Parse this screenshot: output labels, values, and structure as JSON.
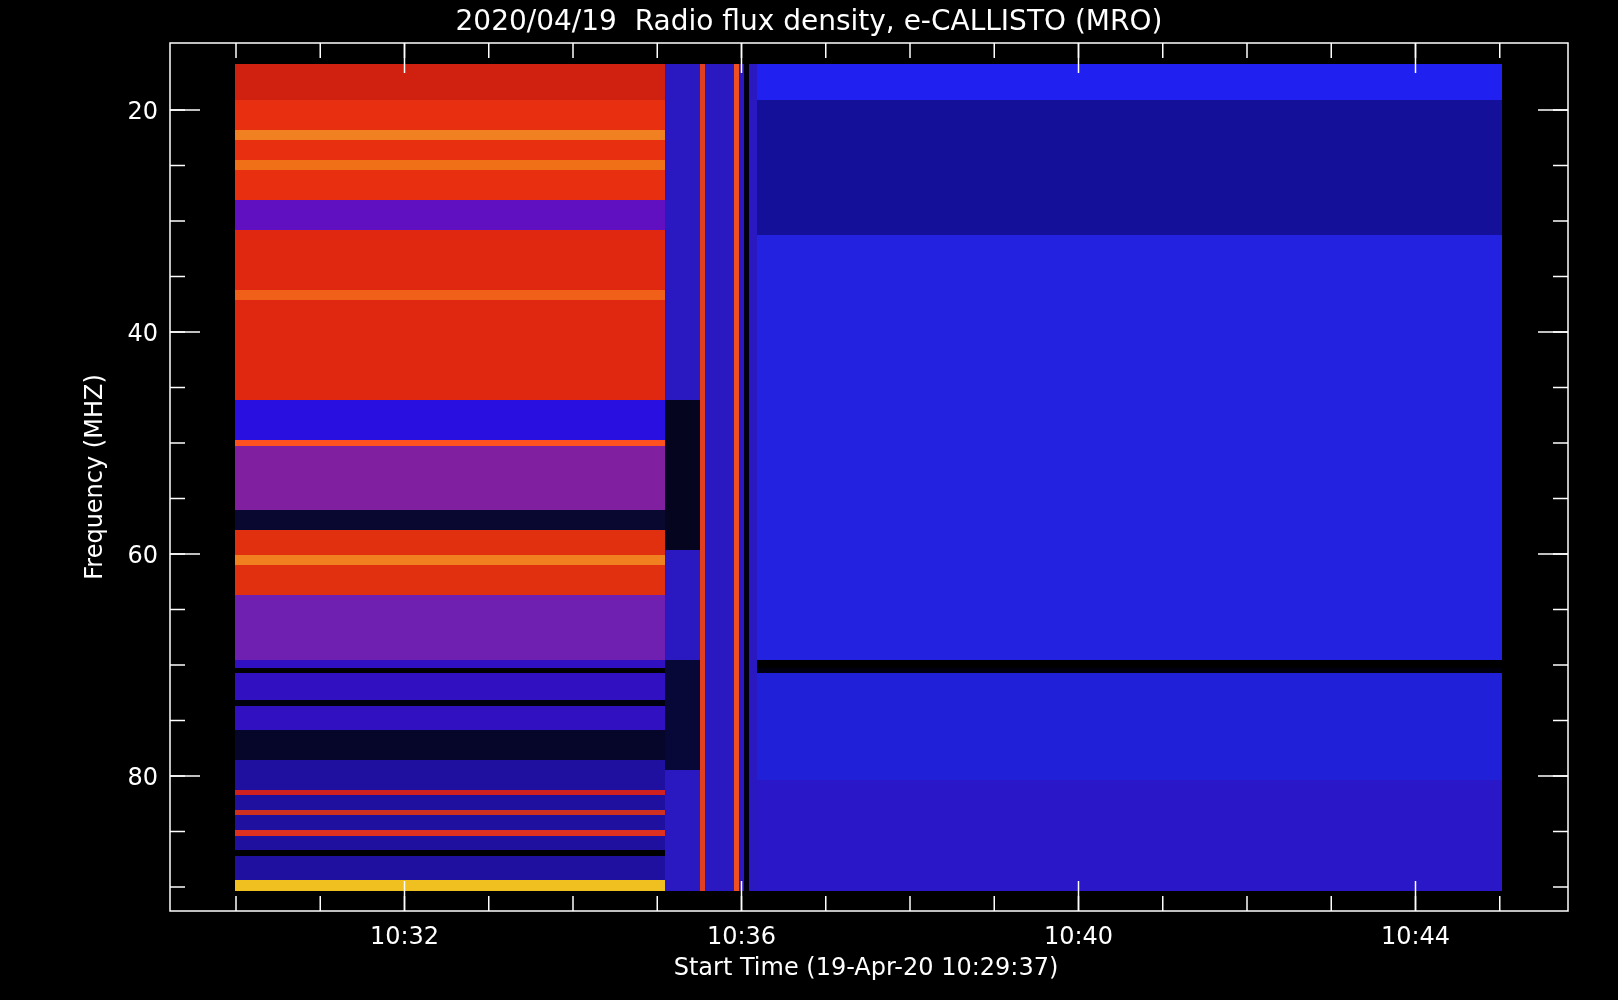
{
  "title": "2020/04/19  Radio flux density, e-CALLISTO (MRO)",
  "y_axis": {
    "label": "Frequency (MHZ)",
    "ticks": [
      "20",
      "40",
      "60",
      "80"
    ]
  },
  "x_axis": {
    "label": "Start Time (19-Apr-20 10:29:37)",
    "ticks": [
      "10:32",
      "10:36",
      "10:40",
      "10:44"
    ]
  }
}
